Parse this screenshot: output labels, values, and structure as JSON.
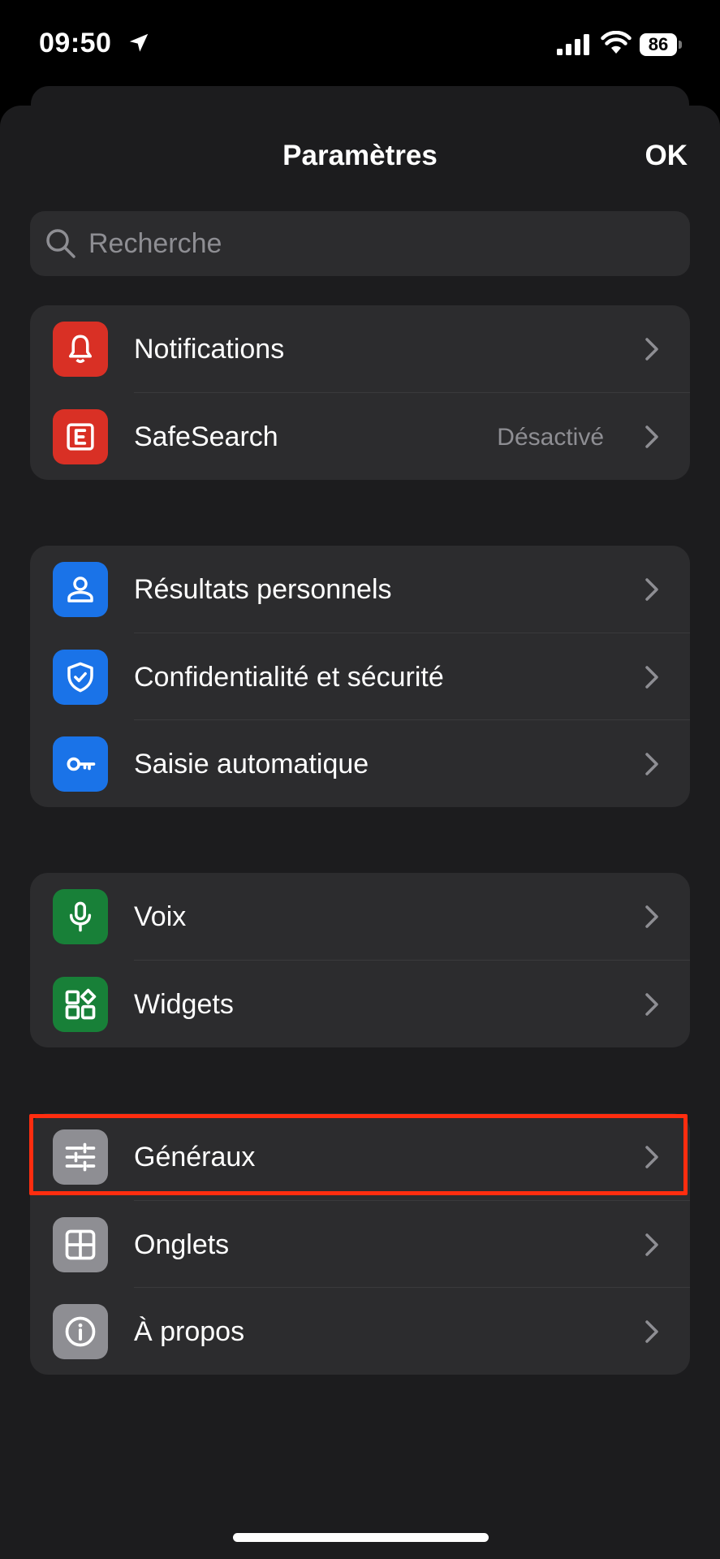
{
  "status_bar": {
    "time": "09:50",
    "battery": "86"
  },
  "nav": {
    "title": "Paramètres",
    "done": "OK"
  },
  "search": {
    "placeholder": "Recherche"
  },
  "groups": [
    {
      "rows": [
        {
          "label": "Notifications",
          "icon": "bell-icon",
          "color": "#d93025"
        },
        {
          "label": "SafeSearch",
          "value": "Désactivé",
          "icon": "safesearch-e-icon",
          "color": "#d93025"
        }
      ]
    },
    {
      "rows": [
        {
          "label": "Résultats personnels",
          "icon": "person-icon",
          "color": "#1a73e8"
        },
        {
          "label": "Confidentialité et sécurité",
          "icon": "shield-check-icon",
          "color": "#1a73e8"
        },
        {
          "label": "Saisie automatique",
          "icon": "key-icon",
          "color": "#1a73e8"
        }
      ]
    },
    {
      "rows": [
        {
          "label": "Voix",
          "icon": "microphone-icon",
          "color": "#188038"
        },
        {
          "label": "Widgets",
          "icon": "widgets-icon",
          "color": "#188038"
        }
      ]
    },
    {
      "rows": [
        {
          "label": "Généraux",
          "icon": "sliders-icon",
          "color": "#8e8e93"
        },
        {
          "label": "Onglets",
          "icon": "tabs-grid-icon",
          "color": "#8e8e93"
        },
        {
          "label": "À propos",
          "icon": "info-icon",
          "color": "#8e8e93"
        }
      ]
    }
  ]
}
